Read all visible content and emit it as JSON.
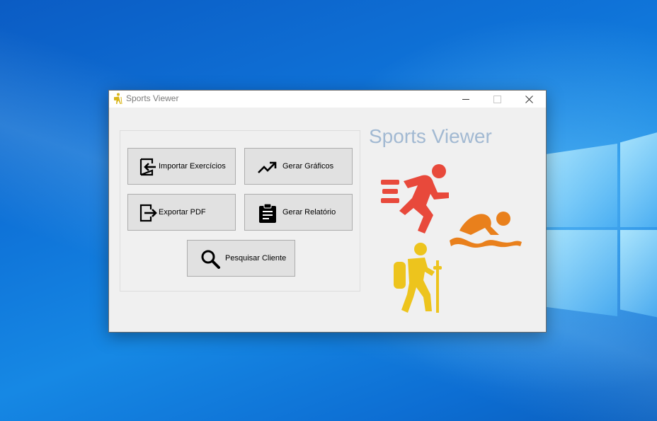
{
  "window": {
    "title": "Sports Viewer",
    "controls": {
      "minimize": "minimize",
      "maximize": "maximize",
      "close": "close"
    }
  },
  "actions": [
    {
      "label": "Importar Exercícios",
      "icon": "import-icon"
    },
    {
      "label": "Gerar Gráficos",
      "icon": "trending-up-icon"
    },
    {
      "label": "Exportar PDF",
      "icon": "export-icon"
    },
    {
      "label": "Gerar Relatório",
      "icon": "clipboard-icon"
    },
    {
      "label": "Pesquisar Cliente",
      "icon": "search-icon"
    }
  ],
  "brand": {
    "title": "Sports Viewer",
    "illustrations": [
      "runner-icon",
      "swimmer-icon",
      "hiker-icon"
    ]
  },
  "colors": {
    "desktop": "#0f73d8",
    "window_bg": "#f0f0f0",
    "button_bg": "#e1e1e1",
    "brand_text": "#a2b9d2",
    "runner": "#e8493b",
    "swimmer": "#e9801c",
    "hiker": "#edc41d"
  }
}
